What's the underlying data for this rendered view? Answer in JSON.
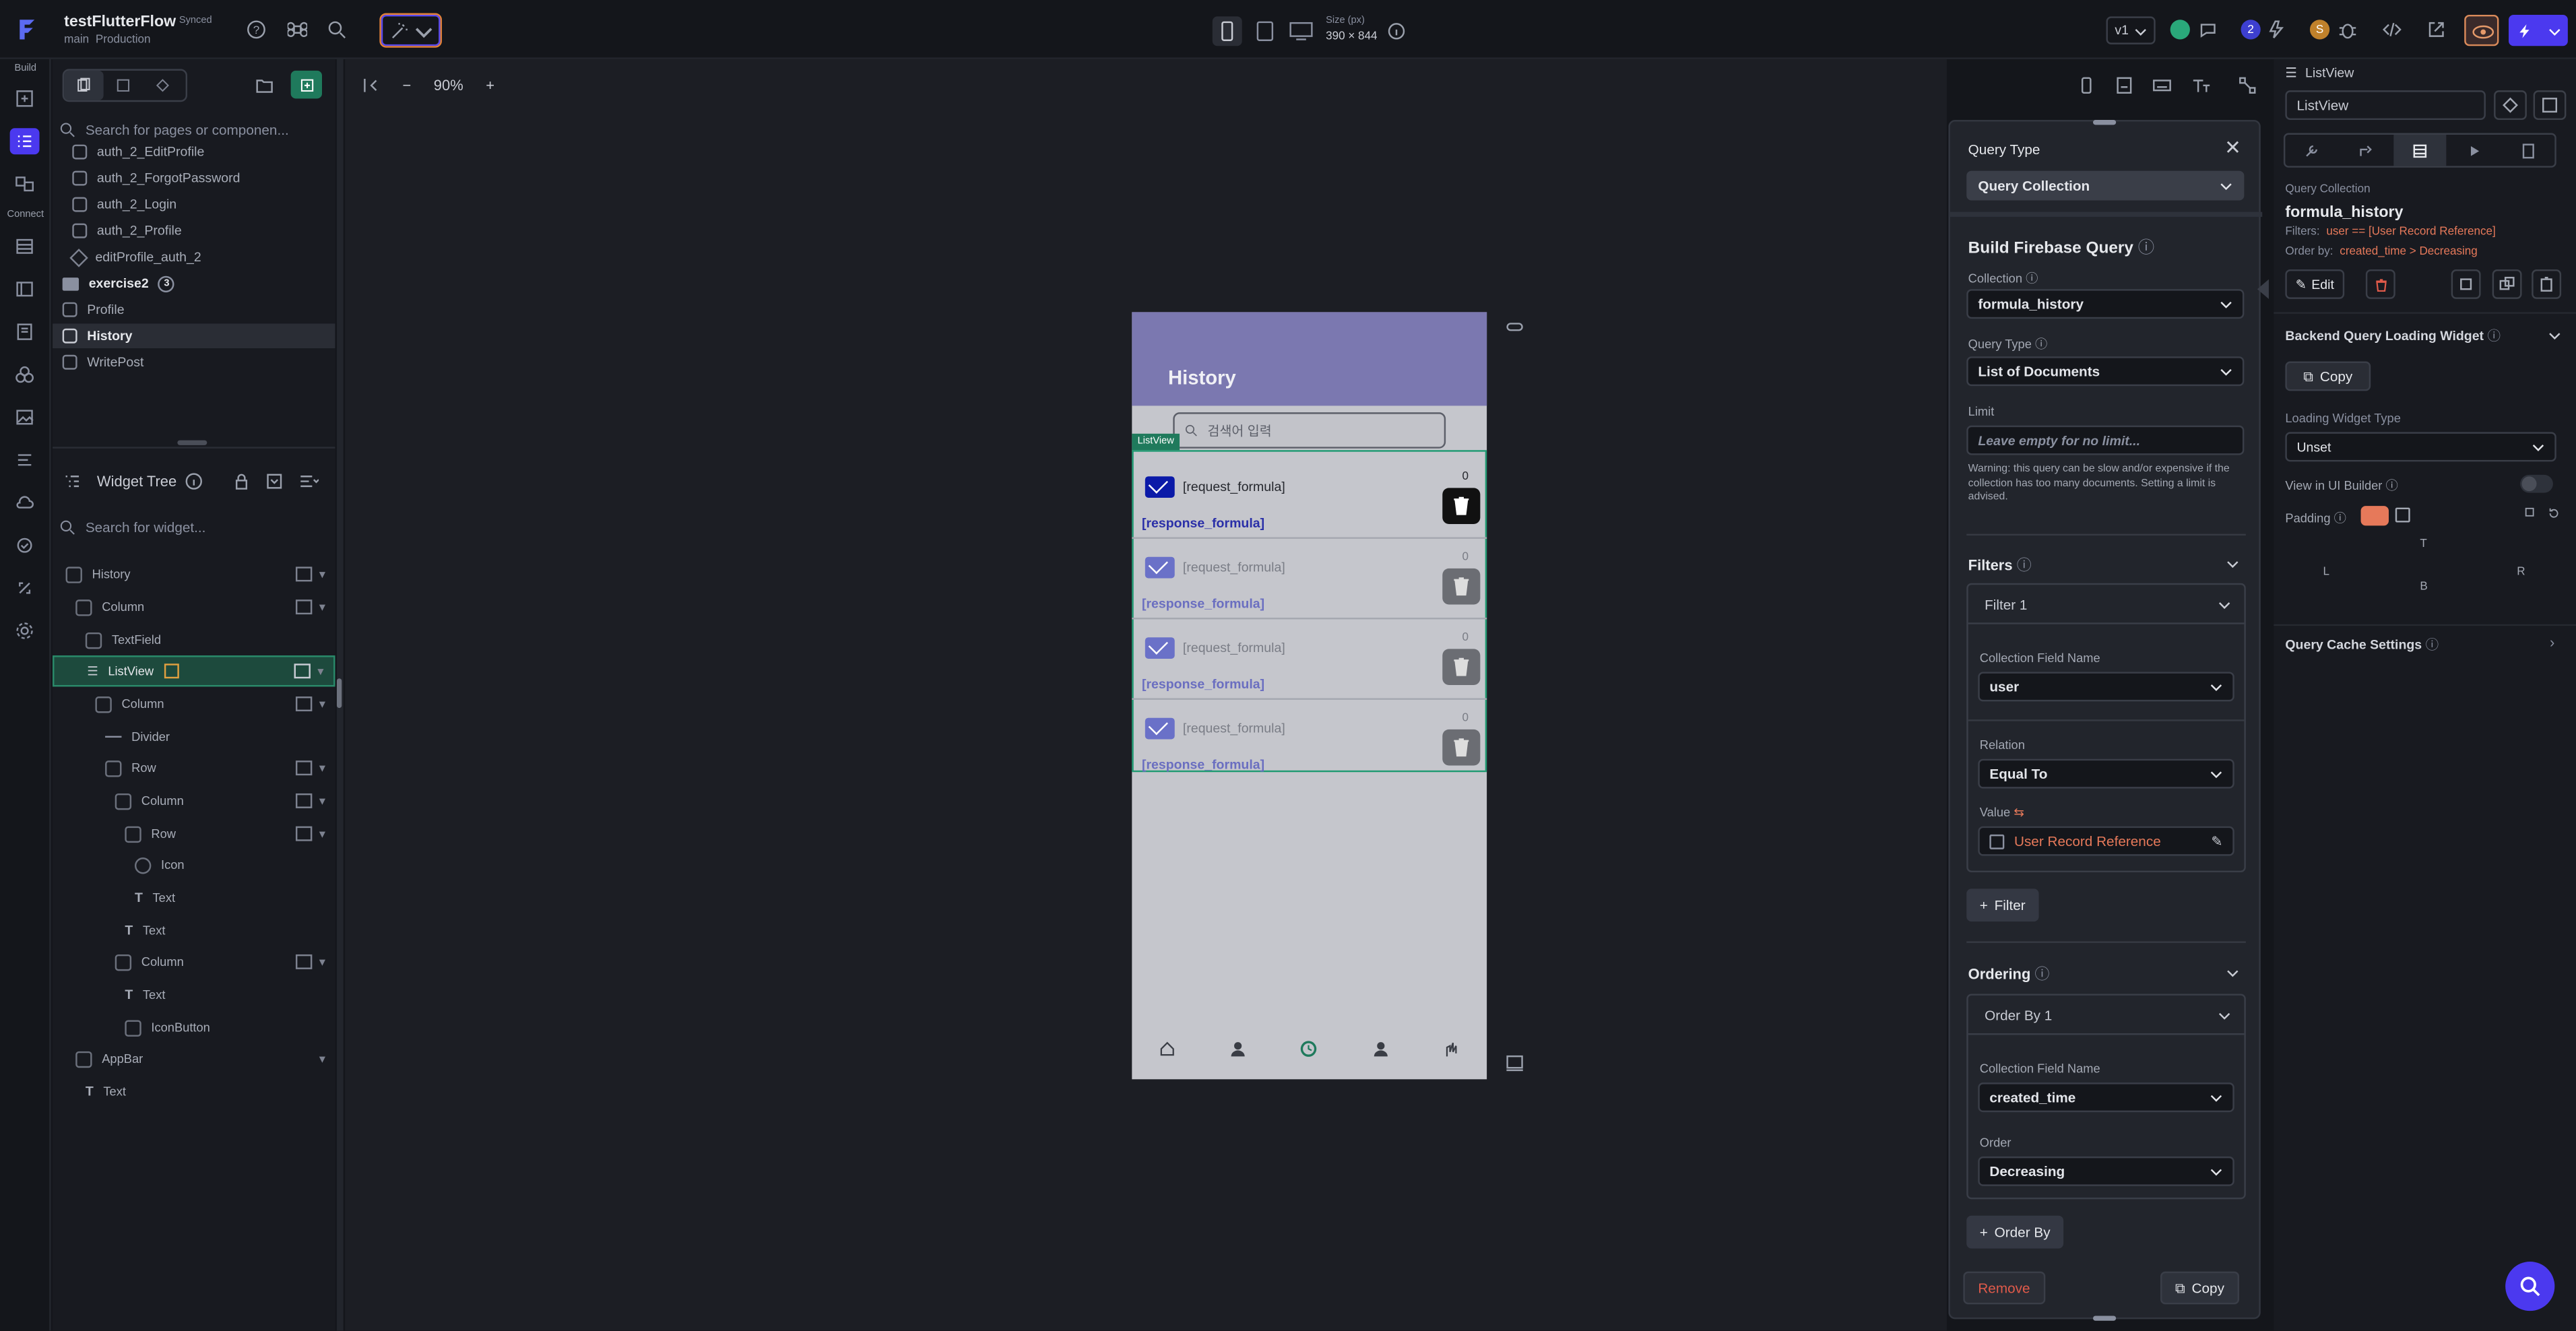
{
  "app": {
    "project_name": "testFlutterFlow",
    "sync_status": "Synced",
    "branch": "main",
    "environment": "Production"
  },
  "toolbar": {
    "size_label": "Size (px)",
    "size_value": "390 × 844",
    "version": "v1",
    "collab_count": "2",
    "user_initial": "S"
  },
  "rail": {
    "build_label": "Build",
    "connect_label": "Connect"
  },
  "pages": {
    "search_placeholder": "Search for pages or componen...",
    "items": [
      "auth_2_EditProfile",
      "auth_2_ForgotPassword",
      "auth_2_Login",
      "auth_2_Profile",
      "editProfile_auth_2"
    ],
    "folder": "exercise2",
    "folder_count": "3",
    "root_items": [
      "Profile",
      "History",
      "WritePost"
    ]
  },
  "widget_tree": {
    "title": "Widget Tree",
    "search_placeholder": "Search for widget...",
    "nodes": [
      "History",
      "Column",
      "TextField",
      "ListView",
      "Column",
      "Divider",
      "Row",
      "Column",
      "Row",
      "Icon",
      "Text",
      "Text",
      "Column",
      "Text",
      "IconButton",
      "AppBar",
      "Text"
    ]
  },
  "canvas": {
    "zoom": "90%",
    "appbar_title": "History",
    "search_placeholder": "검색어 입력",
    "listview_tag": "ListView",
    "rows": [
      {
        "request": "[request_formula]",
        "response": "[response_formula]",
        "count": "0"
      },
      {
        "request": "[request_formula]",
        "response": "[response_formula]",
        "count": "0"
      },
      {
        "request": "[request_formula]",
        "response": "[response_formula]",
        "count": "0"
      },
      {
        "request": "[request_formula]",
        "response": "[response_formula]",
        "count": "0"
      }
    ]
  },
  "query": {
    "header": "Query Type",
    "query_type_value": "Query Collection",
    "build_title": "Build Firebase Query",
    "collection_label": "Collection",
    "collection_value": "formula_history",
    "qtype_label": "Query Type",
    "qtype_value": "List of Documents",
    "limit_label": "Limit",
    "limit_placeholder": "Leave empty for no limit...",
    "warning": "Warning: this query can be slow and/or expensive if the collection has too many documents. Setting a limit is advised.",
    "filters_title": "Filters",
    "filter1": "Filter 1",
    "field_label": "Collection Field Name",
    "field_value": "user",
    "relation_label": "Relation",
    "relation_value": "Equal To",
    "value_label": "Value",
    "value_value": "User Record Reference",
    "add_filter": "Filter",
    "ordering_title": "Ordering",
    "order1": "Order By 1",
    "order_field_label": "Collection Field Name",
    "order_field_value": "created_time",
    "order_label": "Order",
    "order_value": "Decreasing",
    "add_order": "Order By",
    "remove": "Remove",
    "copy": "Copy"
  },
  "props": {
    "crumb": "ListView",
    "name_value": "ListView",
    "qc_label": "Query Collection",
    "qc_value": "formula_history",
    "filters_key": "Filters:",
    "filters_val": "user == [User Record Reference]",
    "order_key": "Order by:",
    "order_val": "created_time > Decreasing",
    "edit": "Edit",
    "loading_title": "Backend Query Loading Widget",
    "copy": "Copy",
    "loading_type_label": "Loading Widget Type",
    "loading_type_value": "Unset",
    "view_ui_builder": "View in UI Builder",
    "padding": "Padding",
    "pad_t": "T",
    "pad_l": "L",
    "pad_r": "R",
    "pad_b": "B",
    "cache": "Query Cache Settings"
  },
  "colors": {
    "accent": "#4b39ef",
    "listview_green": "#1f7a5c",
    "appbar": "#7b78b0",
    "warning": "#e6795a"
  }
}
